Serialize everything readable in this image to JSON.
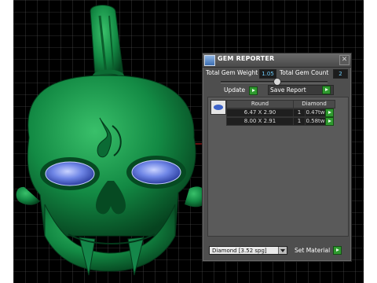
{
  "dialog": {
    "title": "GEM REPORTER",
    "close_glyph": "✕",
    "total_weight_label": "Total Gem Weight",
    "total_weight_value": "1.05",
    "total_count_label": "Total Gem Count",
    "total_count_value": "2",
    "update_label": "Update",
    "save_report_label": "Save Report",
    "table": {
      "headers": [
        "Round",
        "Diamond"
      ],
      "rows": [
        {
          "size": "6.47 X 2.90",
          "qty": "1",
          "weight": "0.47tw"
        },
        {
          "size": "8.00 X 2.91",
          "qty": "1",
          "weight": "0.58tw"
        }
      ]
    },
    "material_value": "Diamond  [3.52 spg]",
    "set_material_label": "Set Material"
  },
  "icons": {
    "app": "gem-reporter-app-icon",
    "close": "close-icon",
    "go": "green-arrow-icon",
    "gem": "round-gem-icon",
    "dropdown": "chevron-down-icon"
  },
  "colors": {
    "panel_bg": "#4e4e4e",
    "model_green": "#1a8f4a",
    "gem_blue": "#6f86e6",
    "value_text": "#6fd0ff",
    "button_green": "#2f9a2f",
    "grid_line": "#5a5a5a",
    "axis_red": "#cc1f1f"
  }
}
